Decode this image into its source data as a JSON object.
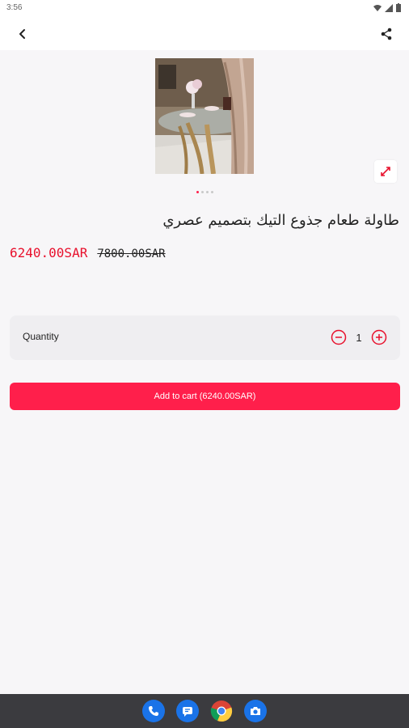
{
  "status_bar": {
    "time": "3:56"
  },
  "header": {
    "back_icon": "chevron-left-icon",
    "share_icon": "share-icon"
  },
  "product": {
    "title": "طاولة طعام جذوع التيك بتصميم عصري",
    "price_current": "6240.00SAR",
    "price_old": "7800.00SAR",
    "image_indicator": {
      "count": 4,
      "active": 0
    }
  },
  "quantity": {
    "label": "Quantity",
    "value": "1"
  },
  "cart": {
    "button_label": "Add to cart (6240.00SAR)"
  },
  "colors": {
    "accent": "#ff1f4b",
    "price": "#e8112d",
    "nav_bar": "#3b3b3f"
  },
  "dock": [
    "phone-icon",
    "messages-icon",
    "chrome-icon",
    "camera-icon"
  ]
}
